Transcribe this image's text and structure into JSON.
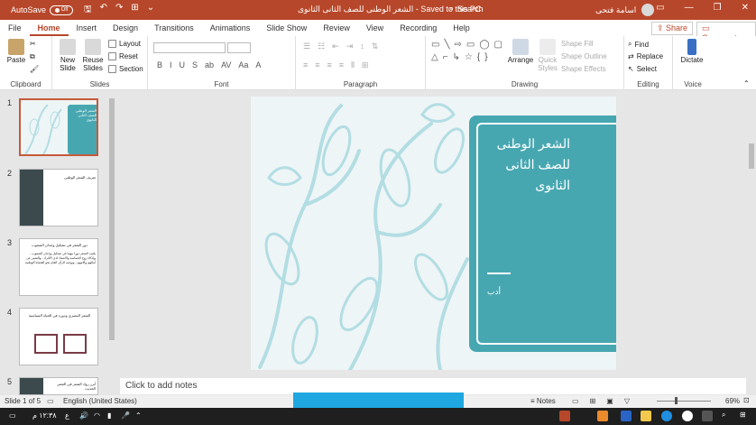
{
  "titlebar": {
    "autosave_label": "AutoSave",
    "autosave_state": "Off",
    "document_title": "الشعر الوطنى للصف الثانى الثانوى  -  Saved to this PC",
    "search_label": "Search",
    "user_name": "اسامة فتحى"
  },
  "tabs": [
    "File",
    "Home",
    "Insert",
    "Design",
    "Transitions",
    "Animations",
    "Slide Show",
    "Review",
    "View",
    "Recording",
    "Help"
  ],
  "active_tab": "Home",
  "share_label": "Share",
  "comments_label": "Comments",
  "ribbon": {
    "clipboard": {
      "paste": "Paste",
      "label": "Clipboard"
    },
    "slides": {
      "new_slide": "New Slide",
      "reuse_slides": "Reuse Slides",
      "layout": "Layout",
      "reset": "Reset",
      "section": "Section",
      "label": "Slides"
    },
    "font": {
      "label": "Font",
      "buttons": [
        "B",
        "I",
        "U",
        "S",
        "ab",
        "AV",
        "Aa",
        "A"
      ]
    },
    "paragraph": {
      "label": "Paragraph"
    },
    "drawing": {
      "arrange": "Arrange",
      "quick_styles": "Quick Styles",
      "shape_fill": "Shape Fill",
      "shape_outline": "Shape Outline",
      "shape_effects": "Shape Effects",
      "label": "Drawing"
    },
    "editing": {
      "find": "Find",
      "replace": "Replace",
      "select": "Select",
      "label": "Editing"
    },
    "voice": {
      "dictate": "Dictate",
      "label": "Voice"
    }
  },
  "thumbnails": [
    {
      "num": "1",
      "title": "الشعر الوطنى للصف الثانى الثانوى"
    },
    {
      "num": "2",
      "title": "تعريف الشعر الوطنى"
    },
    {
      "num": "3",
      "title": "دور الشعر فى تشكيل وجدان الشعوب",
      "body": "يلعب الشعر دورا مهما فى تشكيل وجدان الشعوب ، وإذكاء روح الحماسة والانتماء لدى الأفراد ، والتعبير عن آمالهم وآلامهم ، وتوجيه الرأى العام نحو القضايا الوطنية"
    },
    {
      "num": "4",
      "title": "الشعر المصرى ودوره فى الحياة السياسية"
    },
    {
      "num": "5",
      "title": "أبرز رواد الشعر فى العصر الحديث"
    }
  ],
  "slide": {
    "title": "الشعر الوطنى للصف الثانى الثانوى",
    "subtitle": "أدب"
  },
  "notes_placeholder": "Click to add notes",
  "status": {
    "slide_counter": "Slide 1 of 5",
    "language": "English (United States)",
    "notes": "Notes",
    "zoom": "69%"
  },
  "taskbar": {
    "time": "١٢:٣٨ م",
    "lang": "ع"
  },
  "colors": {
    "accent": "#b7472a",
    "slide_panel": "#47a7b1",
    "slide_bg": "#eef5f6",
    "floral": "#b2dde3"
  }
}
